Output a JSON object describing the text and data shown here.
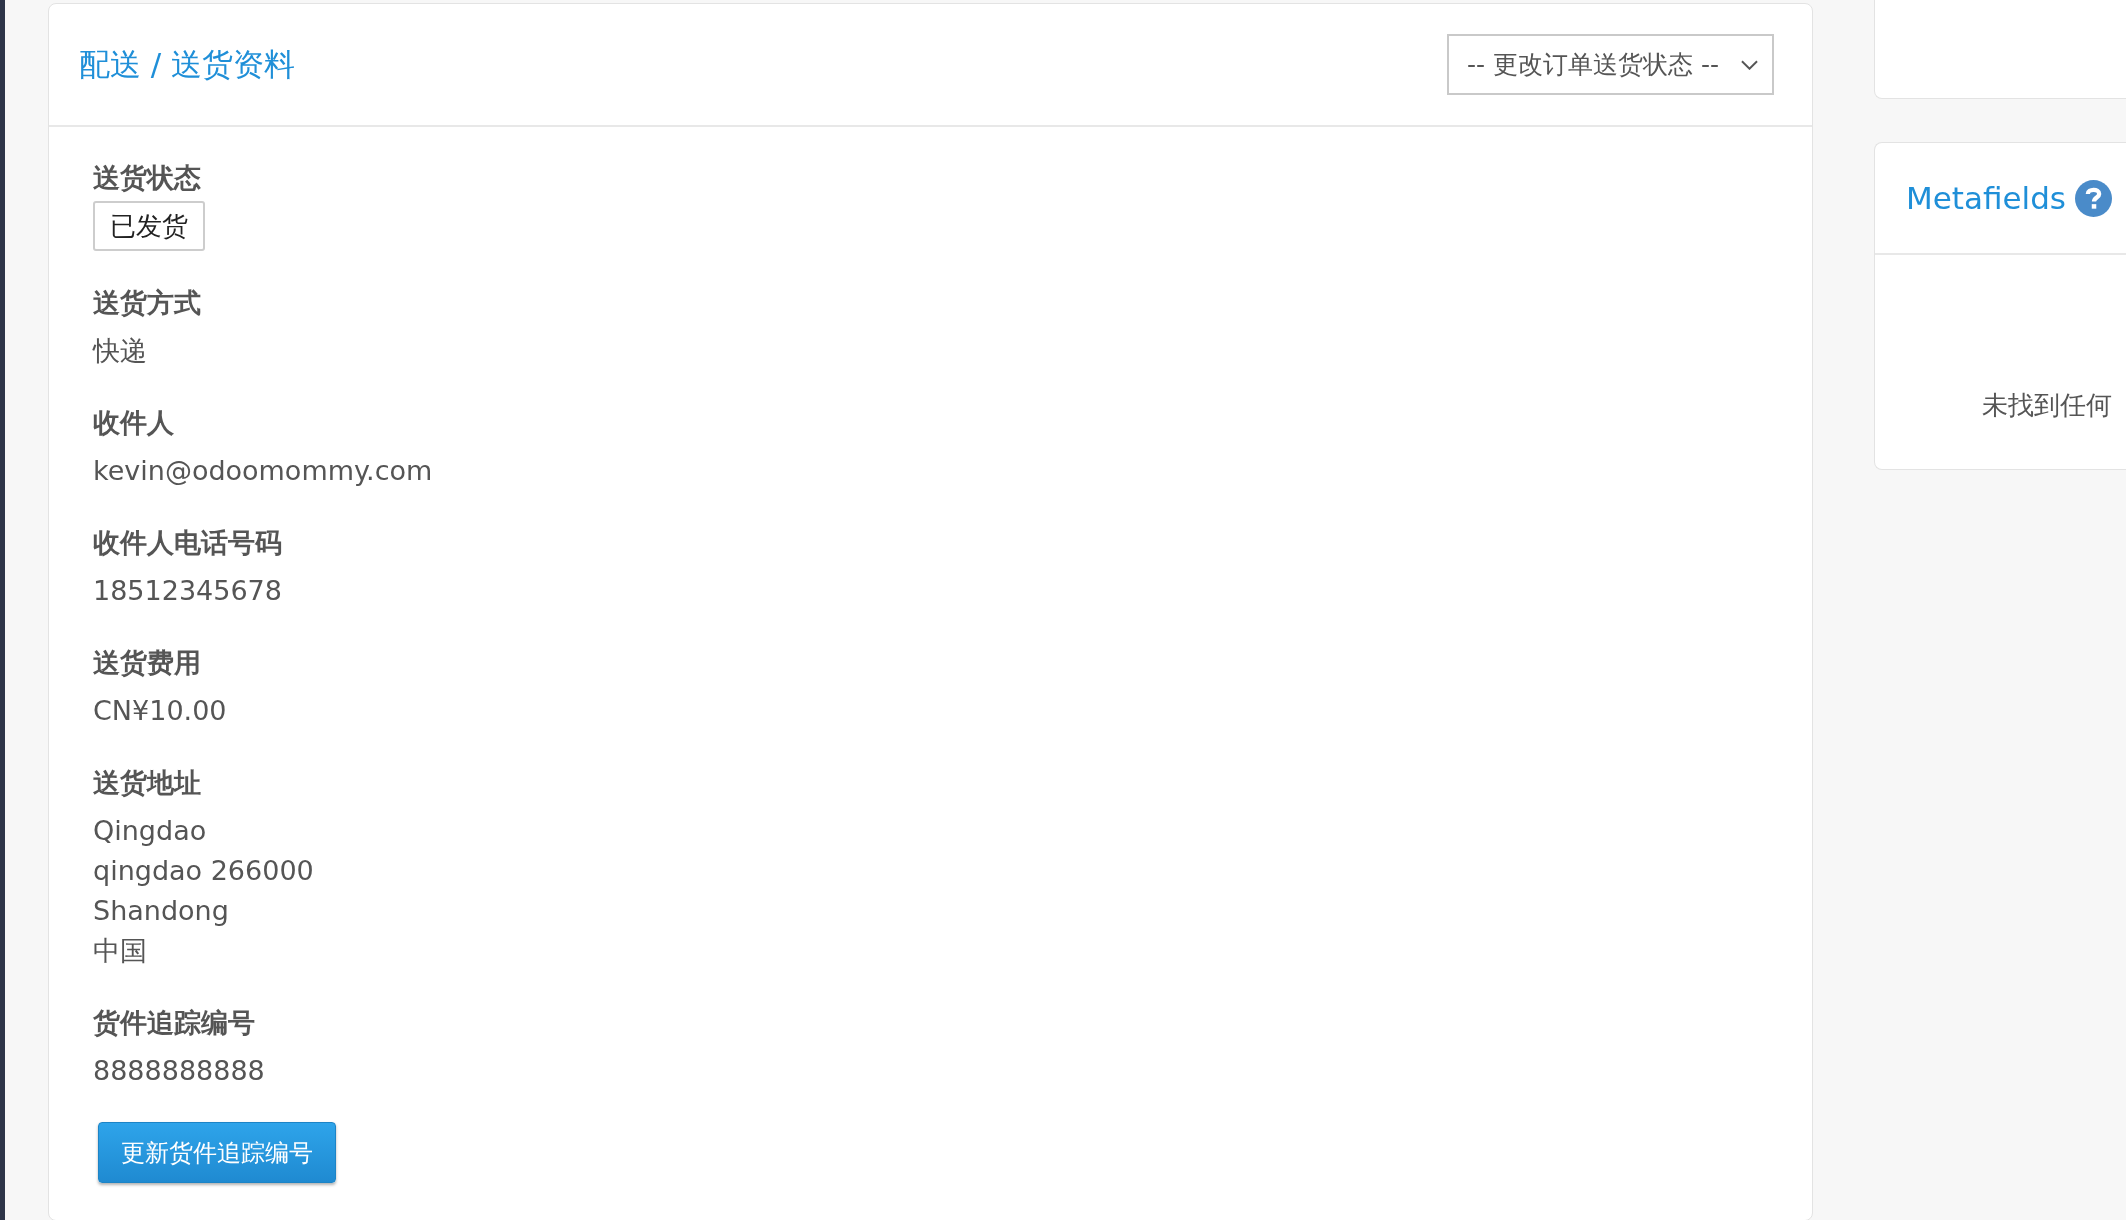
{
  "shipping_info": {
    "title": "配送 / 送货资料",
    "status_select": {
      "value": "-- 更改订单送货状态 --"
    },
    "fields": [
      {
        "kind": "badge",
        "label": "送货状态",
        "value": "已发货"
      },
      {
        "kind": "text",
        "label": "送货方式",
        "value": "快递"
      },
      {
        "kind": "text",
        "label": "收件人",
        "value": "kevin@odoomommy.com"
      },
      {
        "kind": "text",
        "label": "收件人电话号码",
        "value": "18512345678"
      },
      {
        "kind": "text",
        "label": "送货费用",
        "value": "CN¥10.00"
      },
      {
        "kind": "lines",
        "label": "送货地址",
        "lines": [
          "Qingdao",
          "qingdao 266000",
          "Shandong",
          "中国"
        ]
      },
      {
        "kind": "text",
        "label": "货件追踪编号",
        "value": "8888888888"
      }
    ],
    "update_button": "更新货件追踪编号"
  },
  "metafields": {
    "title": "Metafields",
    "message": "未找到任何"
  }
}
